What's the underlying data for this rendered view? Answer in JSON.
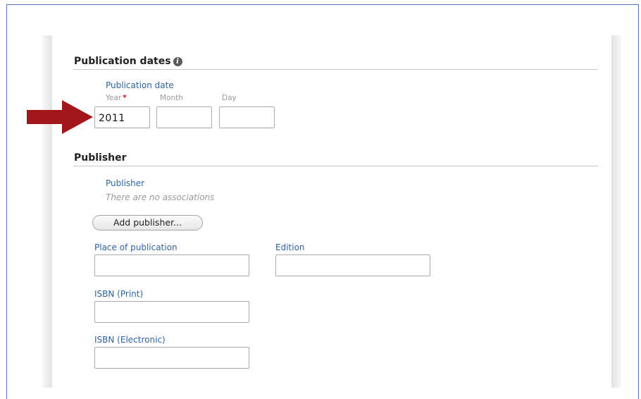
{
  "sections": {
    "publication_dates": {
      "title": "Publication dates",
      "info_icon": "info-icon",
      "field_label": "Publication date",
      "year_label": "Year",
      "required_marker": "*",
      "month_label": "Month",
      "day_label": "Day",
      "year_value": "2011",
      "month_value": "",
      "day_value": ""
    },
    "publisher": {
      "title": "Publisher",
      "field_label": "Publisher",
      "no_associations": "There are no associations",
      "add_button": "Add publisher...",
      "place_label": "Place of publication",
      "place_value": "",
      "edition_label": "Edition",
      "edition_value": "",
      "isbn_print_label": "ISBN (Print)",
      "isbn_print_value": "",
      "isbn_electronic_label": "ISBN (Electronic)",
      "isbn_electronic_value": ""
    }
  },
  "annotation": {
    "arrow_color": "#a3161b",
    "arrow_icon": "right-arrow-icon"
  },
  "colors": {
    "label": "#2e64a0",
    "required": "#c8102e",
    "frame_border": "#4a7ab5"
  }
}
